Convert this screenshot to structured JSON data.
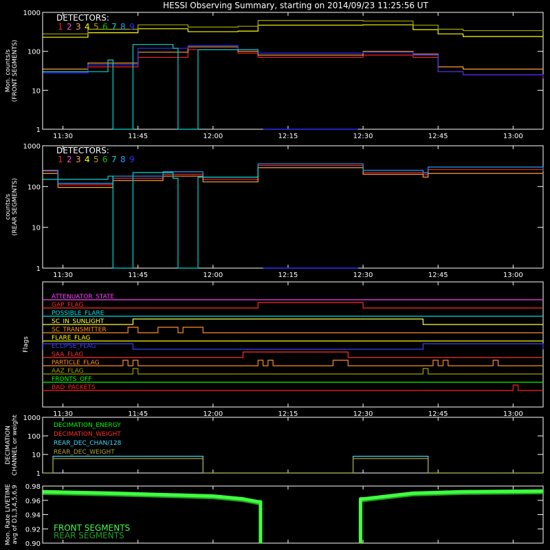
{
  "title": "HESSI Observing Summary, starting on 2014/09/23 11:25:56 UT",
  "time_ticks": [
    "11:30",
    "11:45",
    "12:00",
    "12:15",
    "12:30",
    "12:45",
    "13:00"
  ],
  "colors": {
    "det1": "#ff2020",
    "det2": "#ff50c8",
    "det3": "#ffa040",
    "det4": "#ffff00",
    "det5": "#a8a800",
    "det6": "#00c800",
    "det7": "#00d8d8",
    "det8": "#20a0ff",
    "det9": "#3030ff",
    "axis": "#ffffff"
  },
  "chart_data": [
    {
      "type": "line",
      "panel": "front",
      "ylabel": "Mon. counts/s",
      "ylabel2": "(FRONT SEGMENTS)",
      "yscale": "log",
      "ylim": [
        1,
        1000
      ],
      "yticks": [
        "1",
        "10",
        "100",
        "1000"
      ],
      "xlim": [
        "11:25:56",
        "13:06:00"
      ],
      "legend_title": "DETECTORS:",
      "legend_labels": [
        "1",
        "2",
        "3",
        "4",
        "5",
        "6",
        "7",
        "8",
        "9"
      ],
      "data_gap": [
        "12:10",
        "12:29"
      ],
      "series": [
        {
          "name": "1",
          "color": "det1",
          "x": [
            "11:26",
            "11:35",
            "11:45",
            "11:55",
            "12:05",
            "12:09",
            "12:30",
            "12:40",
            "12:45",
            "12:50",
            "13:06"
          ],
          "y": [
            30,
            40,
            70,
            110,
            90,
            70,
            80,
            70,
            30,
            25,
            20
          ]
        },
        {
          "name": "3",
          "color": "det3",
          "x": [
            "11:26",
            "11:35",
            "11:45",
            "11:55",
            "12:05",
            "12:09",
            "12:30",
            "12:40",
            "12:45",
            "12:50",
            "13:06"
          ],
          "y": [
            35,
            50,
            95,
            130,
            100,
            80,
            100,
            85,
            40,
            35,
            35
          ]
        },
        {
          "name": "4",
          "color": "det4",
          "x": [
            "11:26",
            "11:35",
            "11:45",
            "11:55",
            "12:05",
            "12:09",
            "12:30",
            "12:40",
            "12:45",
            "12:50",
            "13:06"
          ],
          "y": [
            230,
            300,
            380,
            320,
            330,
            470,
            480,
            360,
            280,
            240,
            230
          ]
        },
        {
          "name": "5",
          "color": "det5",
          "x": [
            "11:26",
            "11:35",
            "11:45",
            "11:55",
            "12:05",
            "12:09",
            "12:30",
            "12:40",
            "12:45",
            "12:50",
            "13:06"
          ],
          "y": [
            280,
            370,
            480,
            420,
            440,
            620,
            600,
            470,
            370,
            340,
            330
          ]
        },
        {
          "name": "9",
          "color": "det9",
          "x": [
            "11:26",
            "11:35",
            "11:45",
            "11:55",
            "12:05",
            "12:09",
            "12:30",
            "12:40",
            "12:45",
            "12:50",
            "13:06"
          ],
          "y": [
            28,
            45,
            120,
            140,
            110,
            90,
            95,
            80,
            30,
            25,
            22
          ]
        },
        {
          "name": "7",
          "color": "det7",
          "x": [
            "11:26",
            "11:39",
            "11:40",
            "11:43",
            "11:44",
            "11:52",
            "11:53",
            "11:56",
            "11:57",
            "12:09"
          ],
          "y": [
            30,
            60,
            1,
            1,
            150,
            120,
            1,
            1,
            110,
            90
          ]
        }
      ]
    },
    {
      "type": "line",
      "panel": "rear",
      "ylabel": "counts/s",
      "ylabel2": "(REAR SEGMENTS)",
      "yscale": "log",
      "ylim": [
        1,
        1000
      ],
      "yticks": [
        "1",
        "10",
        "100",
        "1000"
      ],
      "xlim": [
        "11:25:56",
        "13:06:00"
      ],
      "legend_title": "DETECTORS:",
      "legend_labels": [
        "1",
        "2",
        "3",
        "4",
        "5",
        "6",
        "7",
        "8",
        "9"
      ],
      "data_gap": [
        "12:10",
        "12:29"
      ],
      "series": [
        {
          "name": "1",
          "color": "det1",
          "x": [
            "11:26",
            "11:28",
            "11:29",
            "11:40",
            "11:50",
            "11:58",
            "12:09",
            "12:30",
            "12:42",
            "12:43",
            "13:06"
          ],
          "y": [
            240,
            240,
            110,
            160,
            200,
            150,
            330,
            220,
            200,
            260,
            240
          ]
        },
        {
          "name": "3",
          "color": "det3",
          "x": [
            "11:26",
            "11:28",
            "11:29",
            "11:40",
            "11:50",
            "11:58",
            "12:09",
            "12:30",
            "12:42",
            "12:43",
            "13:06"
          ],
          "y": [
            210,
            210,
            95,
            140,
            180,
            130,
            290,
            200,
            170,
            210,
            200
          ]
        },
        {
          "name": "8",
          "color": "det8",
          "x": [
            "11:26",
            "11:28",
            "11:29",
            "11:40",
            "11:50",
            "11:58",
            "12:09",
            "12:30",
            "12:42",
            "12:43",
            "13:06"
          ],
          "y": [
            250,
            250,
            120,
            180,
            230,
            170,
            360,
            250,
            220,
            300,
            250
          ]
        },
        {
          "name": "7",
          "color": "det7",
          "x": [
            "11:26",
            "11:39",
            "11:40",
            "11:43",
            "11:44",
            "11:52",
            "11:53",
            "11:56",
            "11:57",
            "12:09"
          ],
          "y": [
            150,
            180,
            1,
            1,
            220,
            160,
            1,
            1,
            170,
            300
          ]
        }
      ]
    },
    {
      "type": "line",
      "panel": "flags",
      "ylabel": "Flags",
      "flags": [
        {
          "label": "ATTENUATOR_STATE",
          "color": "#ff40ff",
          "state": []
        },
        {
          "label": "GAP_FLAG",
          "color": "#ff3020",
          "state": [
            [
              "12:09",
              "12:30"
            ]
          ]
        },
        {
          "label": "POSSIBLE_FLARE",
          "color": "#00e0e0",
          "state": []
        },
        {
          "label": "SC_IN_SUNLIGHT",
          "color": "#ffff40",
          "state": [
            [
              "11:44",
              "12:42"
            ]
          ]
        },
        {
          "label": "SC_TRANSMITTER",
          "color": "#ff9020",
          "state": [
            [
              "11:43",
              "11:45"
            ],
            [
              "11:49",
              "11:53"
            ],
            [
              "11:54",
              "11:58"
            ]
          ]
        },
        {
          "label": "FLARE_FLAG",
          "color": "#ffff00",
          "state": []
        },
        {
          "label": "ECLIPSE_FLAG",
          "color": "#4040ff",
          "state": [
            [
              "11:26",
              "11:44"
            ],
            [
              "12:42",
              "13:06"
            ]
          ]
        },
        {
          "label": "SAA_FLAG",
          "color": "#ff3030",
          "state": [
            [
              "12:06",
              "12:27"
            ]
          ]
        },
        {
          "label": "PARTICLE_FLAG",
          "color": "#ff9020",
          "state": [
            [
              "11:42",
              "11:43"
            ],
            [
              "11:44",
              "11:45"
            ],
            [
              "12:09",
              "12:10"
            ],
            [
              "12:11",
              "12:12"
            ],
            [
              "12:24",
              "12:27"
            ],
            [
              "12:44",
              "12:45"
            ],
            [
              "12:46",
              "12:47"
            ],
            [
              "12:56",
              "12:57"
            ]
          ]
        },
        {
          "label": "AAZ_FLAG",
          "color": "#a0a000",
          "state": [
            [
              "11:44",
              "11:45"
            ],
            [
              "12:42",
              "12:43"
            ]
          ]
        },
        {
          "label": "FRONTS_OFF",
          "color": "#00ff00",
          "state": []
        },
        {
          "label": "BAD_PACKETS",
          "color": "#ff2020",
          "state": [
            [
              "13:00",
              "13:01"
            ]
          ]
        }
      ]
    },
    {
      "type": "line",
      "panel": "decimation",
      "ylabel": "DECIMATION",
      "ylabel2": "CHANNEL or weight",
      "yscale": "log",
      "ylim": [
        1,
        1000
      ],
      "yticks": [
        "1",
        "10",
        "100",
        "1000"
      ],
      "legend_labels": [
        "DECIMATION_ENERGY",
        "DECIMATION_WEIGHT",
        "REAR_DEC_CHAN/128",
        "REAR_DEC_WEIGHT"
      ],
      "series": [
        {
          "name": "DECIMATION_ENERGY",
          "color": "#00ff00",
          "x": [],
          "y": []
        },
        {
          "name": "DECIMATION_WEIGHT",
          "color": "#ff3020",
          "x": [],
          "y": []
        },
        {
          "name": "REAR_DEC_CHAN/128",
          "color": "#40d8ff",
          "x": [
            "11:26",
            "11:28",
            "11:28",
            "11:58",
            "11:58",
            "12:28",
            "12:28",
            "12:43",
            "12:43",
            "13:06"
          ],
          "y": [
            1,
            1,
            8,
            8,
            1,
            1,
            8,
            8,
            1,
            1
          ]
        },
        {
          "name": "REAR_DEC_WEIGHT",
          "color": "#b0a030",
          "x": [
            "11:26",
            "11:28",
            "11:28",
            "11:58",
            "11:58",
            "12:28",
            "12:28",
            "12:43",
            "12:43",
            "13:06"
          ],
          "y": [
            1,
            1,
            6,
            6,
            1,
            1,
            6,
            6,
            1,
            1
          ]
        }
      ]
    },
    {
      "type": "line",
      "panel": "livetime",
      "ylabel": "Mon. Rate LIVETIME",
      "ylabel2": "avg of D1,3,4,5,6,9",
      "ylim": [
        0.9,
        0.98
      ],
      "yticks": [
        "0.90",
        "0.92",
        "0.94",
        "0.96",
        "0.98"
      ],
      "legend_labels": [
        "FRONT SEGMENTS",
        "REAR SEGMENTS"
      ],
      "series": [
        {
          "name": "FRONT SEGMENTS",
          "color": "#40ff40",
          "x": [
            "11:26",
            "11:40",
            "11:50",
            "12:00",
            "12:06",
            "12:09",
            "12:30",
            "12:40",
            "12:50",
            "13:06"
          ],
          "y": [
            0.972,
            0.97,
            0.968,
            0.966,
            0.962,
            0.958,
            0.962,
            0.97,
            0.972,
            0.973
          ]
        },
        {
          "name": "REAR SEGMENTS",
          "color": "#20a020",
          "x": [
            "11:26",
            "11:40",
            "11:50",
            "12:00",
            "12:06",
            "12:09",
            "12:30",
            "12:40",
            "12:50",
            "13:06"
          ],
          "y": [
            0.97,
            0.968,
            0.966,
            0.964,
            0.96,
            0.956,
            0.96,
            0.968,
            0.97,
            0.971
          ]
        }
      ]
    }
  ]
}
